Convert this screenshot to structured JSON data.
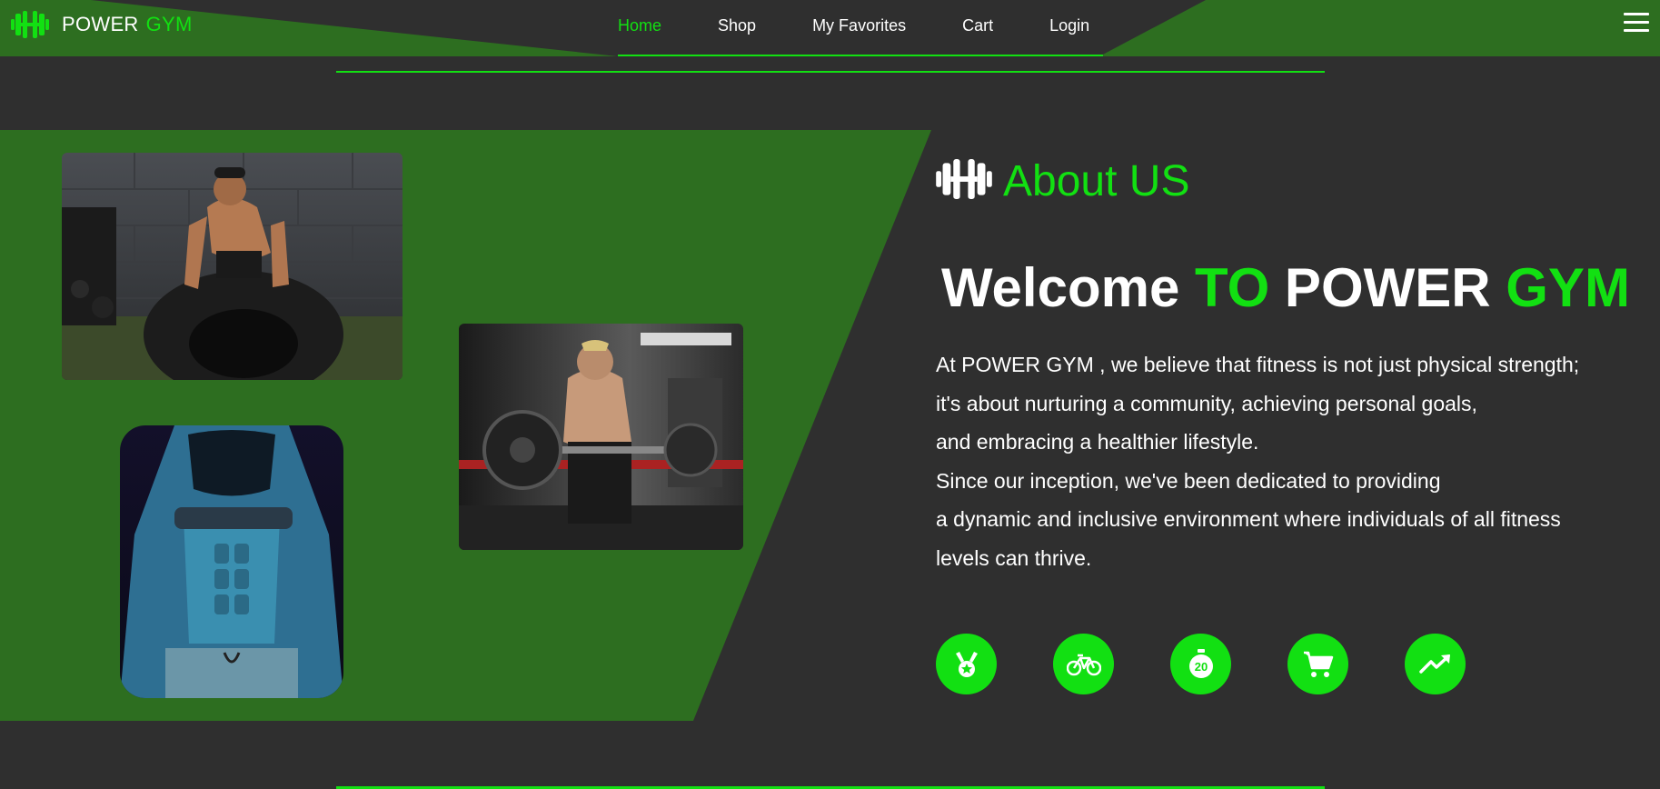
{
  "brand": {
    "name_part1": "POWER",
    "name_part2": "GYM",
    "icon": "dumbbell-icon",
    "accent_color": "#12e012",
    "green_color": "#2d6e20",
    "dark_color": "#2f2f2f"
  },
  "nav": {
    "items": [
      {
        "label": "Home",
        "active": true
      },
      {
        "label": "Shop",
        "active": false
      },
      {
        "label": "My Favorites",
        "active": false
      },
      {
        "label": "Cart",
        "active": false
      },
      {
        "label": "Login",
        "active": false
      }
    ],
    "menu_icon": "hamburger-menu-icon"
  },
  "about": {
    "title": "About US",
    "title_icon": "dumbbell-icon",
    "welcome": {
      "w1": "Welcome",
      "w2": "TO",
      "w3": "POWER",
      "w4": "GYM"
    },
    "body_lines": [
      "At POWER GYM , we believe that fitness is not just physical strength;",
      "it's about nurturing a community, achieving personal goals,",
      "and embracing a healthier lifestyle.",
      "Since our inception, we've been dedicated to providing",
      "a dynamic and inclusive environment where individuals of all fitness",
      "levels can thrive."
    ],
    "features": [
      {
        "icon": "medal-icon"
      },
      {
        "icon": "bicycle-icon"
      },
      {
        "icon": "stopwatch-20-icon",
        "text": "20"
      },
      {
        "icon": "cart-icon"
      },
      {
        "icon": "trending-up-icon"
      }
    ]
  }
}
